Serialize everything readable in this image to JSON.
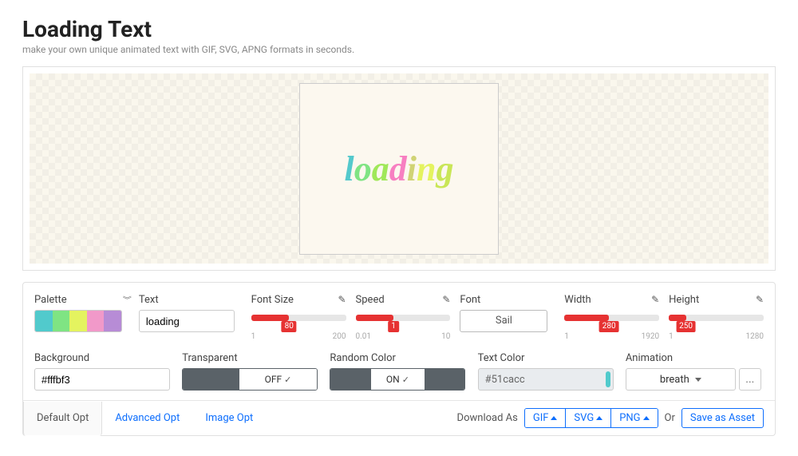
{
  "header": {
    "title": "Loading Text",
    "subtitle": "make your own unique animated text with GIF, SVG, APNG formats in seconds."
  },
  "preview": {
    "text": "loading",
    "chars": [
      "l",
      "o",
      "a",
      "d",
      "i",
      "n",
      "g"
    ]
  },
  "controls": {
    "palette": {
      "label": "Palette",
      "colors": [
        "#51cacc",
        "#7fe483",
        "#e4f35f",
        "#f199c9",
        "#b78cd6"
      ]
    },
    "text_field": {
      "label": "Text",
      "value": "loading"
    },
    "font_size": {
      "label": "Font Size",
      "min": "1",
      "max": "200",
      "value": "80",
      "fill_pct": 40
    },
    "speed": {
      "label": "Speed",
      "min": "0.01",
      "max": "10",
      "value": "1",
      "fill_pct": 40
    },
    "font": {
      "label": "Font",
      "value": "Sail"
    },
    "width": {
      "label": "Width",
      "min": "1",
      "max": "1920",
      "value": "280",
      "fill_pct": 47
    },
    "height": {
      "label": "Height",
      "min": "1",
      "max": "1280",
      "value": "250",
      "fill_pct": 18
    },
    "background": {
      "label": "Background",
      "value": "#fffbf3"
    },
    "transparent": {
      "label": "Transparent",
      "state": "OFF"
    },
    "random_color": {
      "label": "Random Color",
      "state": "ON"
    },
    "text_color": {
      "label": "Text Color",
      "value": "#51cacc"
    },
    "animation": {
      "label": "Animation",
      "value": "breath",
      "more": "..."
    }
  },
  "tabs": {
    "default_opt": "Default Opt",
    "advanced_opt": "Advanced Opt",
    "image_opt": "Image Opt"
  },
  "download": {
    "label": "Download As",
    "gif": "GIF",
    "svg": "SVG",
    "png": "PNG",
    "or": "Or",
    "save": "Save as Asset"
  }
}
